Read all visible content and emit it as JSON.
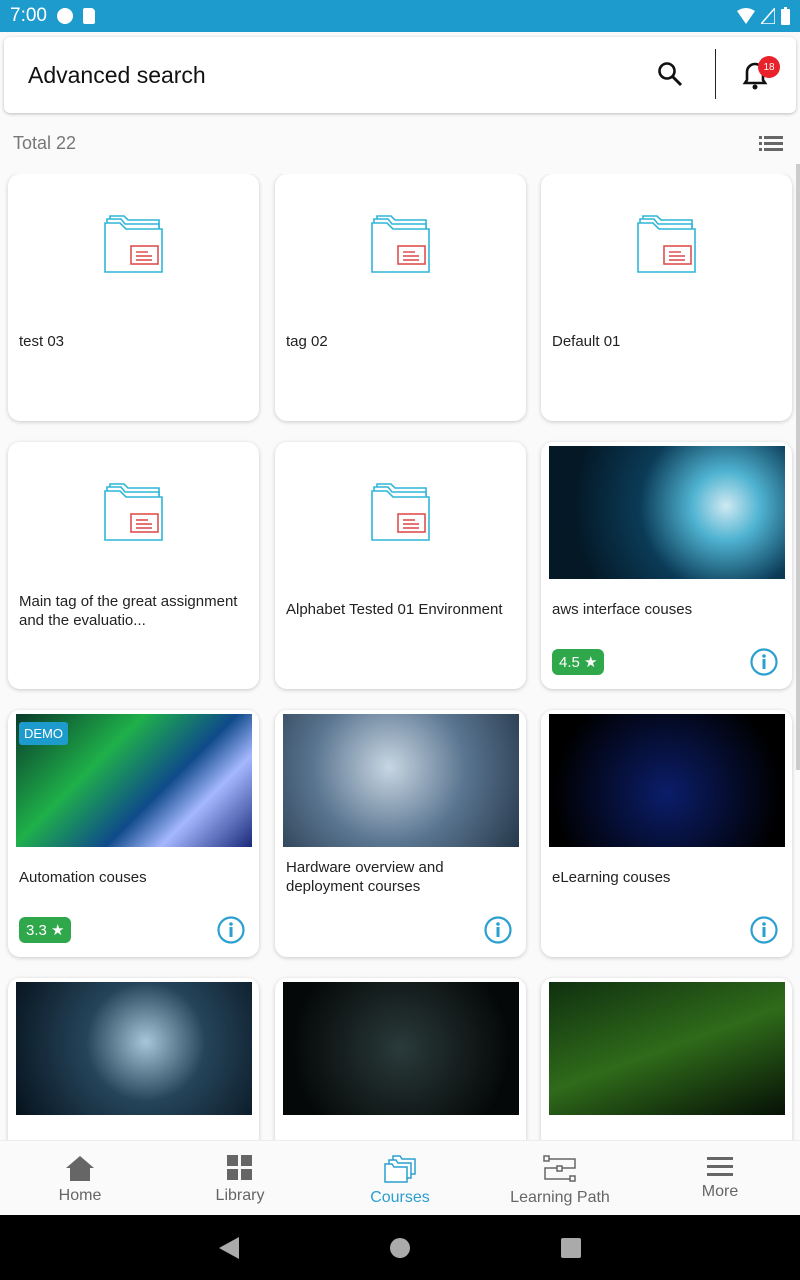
{
  "status_bar": {
    "time": "7:00"
  },
  "header": {
    "title": "Advanced search",
    "notification_count": "18"
  },
  "summary": {
    "total": "Total 22"
  },
  "courses": [
    {
      "title": "test 03",
      "type": "folder"
    },
    {
      "title": "tag 02",
      "type": "folder"
    },
    {
      "title": "Default 01",
      "type": "folder"
    },
    {
      "title": "Main tag of the great assignment and the evaluatio...",
      "type": "folder"
    },
    {
      "title": "Alphabet Tested 01 Environment",
      "type": "folder"
    },
    {
      "title": "aws interface couses",
      "type": "image",
      "rating": "4.5 ★"
    },
    {
      "title": "Automation couses",
      "type": "image",
      "rating": "3.3 ★",
      "badge": "DEMO"
    },
    {
      "title": "Hardware overview and deployment courses",
      "type": "image"
    },
    {
      "title": "eLearning couses",
      "type": "image"
    },
    {
      "title": "",
      "type": "image"
    },
    {
      "title": "",
      "type": "image"
    },
    {
      "title": "",
      "type": "image"
    }
  ],
  "bottom_nav": [
    {
      "label": "Home",
      "icon": "home-icon"
    },
    {
      "label": "Library",
      "icon": "grid-icon"
    },
    {
      "label": "Courses",
      "icon": "folders-icon",
      "active": true
    },
    {
      "label": "Learning Path",
      "icon": "flow-icon"
    },
    {
      "label": "More",
      "icon": "menu-icon"
    }
  ],
  "colors": {
    "accent": "#1e9bcd",
    "rating": "#2ea84a",
    "badge": "#e8212b"
  }
}
